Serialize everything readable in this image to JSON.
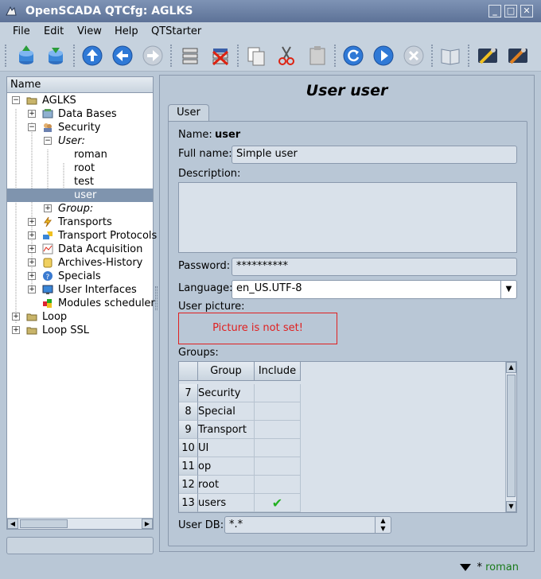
{
  "window": {
    "title": "OpenSCADA QTCfg: AGLKS",
    "minimize": "_",
    "maximize": "□",
    "close": "✕"
  },
  "menu": {
    "items": [
      "File",
      "Edit",
      "View",
      "Help",
      "QTStarter"
    ]
  },
  "toolbar": {
    "buttons": [
      "db-load-icon",
      "db-save-icon",
      "up-icon",
      "back-icon",
      "forward-icon",
      "add-item-icon",
      "delete-item-icon",
      "copy-icon",
      "cut-icon",
      "paste-icon",
      "refresh-icon",
      "start-icon",
      "stop-icon",
      "manual-icon",
      "tools-icon",
      "tools2-icon"
    ]
  },
  "tree": {
    "header": "Name",
    "nodes": [
      {
        "label": "AGLKS",
        "icon": "folder",
        "expander": "-"
      },
      {
        "label": "Data Bases",
        "icon": "db",
        "expander": "+"
      },
      {
        "label": "Security",
        "icon": "security",
        "expander": "-"
      },
      {
        "label": "User:",
        "icon": "",
        "expander": "-"
      },
      {
        "label": "roman",
        "icon": "",
        "expander": ""
      },
      {
        "label": "root",
        "icon": "",
        "expander": ""
      },
      {
        "label": "test",
        "icon": "",
        "expander": ""
      },
      {
        "label": "user",
        "icon": "",
        "expander": ""
      },
      {
        "label": "Group:",
        "icon": "",
        "expander": "+"
      },
      {
        "label": "Transports",
        "icon": "bolt",
        "expander": "+"
      },
      {
        "label": "Transport Protocols",
        "icon": "proto",
        "expander": "+"
      },
      {
        "label": "Data Acquisition",
        "icon": "chart",
        "expander": "+"
      },
      {
        "label": "Archives-History",
        "icon": "archive",
        "expander": "+"
      },
      {
        "label": "Specials",
        "icon": "help",
        "expander": "+"
      },
      {
        "label": "User Interfaces",
        "icon": "ui",
        "expander": "+"
      },
      {
        "label": "Modules scheduler",
        "icon": "modules",
        "expander": ""
      },
      {
        "label": "Loop",
        "icon": "folder",
        "expander": "+"
      },
      {
        "label": "Loop SSL",
        "icon": "folder",
        "expander": "+"
      }
    ]
  },
  "page": {
    "title": "User user",
    "tab": "User",
    "name_label": "Name:",
    "name_value": "user",
    "fullname_label": "Full name:",
    "fullname_value": "Simple user",
    "description_label": "Description:",
    "password_label": "Password:",
    "password_value": "**********",
    "language_label": "Language:",
    "language_value": "en_US.UTF-8",
    "picture_label": "User picture:",
    "picture_text": "Picture is not set!",
    "groups_label": "Groups:",
    "groups_columns": [
      "Group",
      "Include"
    ],
    "groups_rows": [
      {
        "n": "7",
        "group": "Security",
        "include": ""
      },
      {
        "n": "8",
        "group": "Special",
        "include": ""
      },
      {
        "n": "9",
        "group": "Transport",
        "include": ""
      },
      {
        "n": "10",
        "group": "UI",
        "include": ""
      },
      {
        "n": "11",
        "group": "op",
        "include": ""
      },
      {
        "n": "12",
        "group": "root",
        "include": ""
      },
      {
        "n": "13",
        "group": "users",
        "include": "✔"
      }
    ],
    "userdb_label": "User DB:",
    "userdb_value": "*.*"
  },
  "status": {
    "star": "*",
    "user": "roman"
  },
  "colors": {
    "selection": "#7f94ae",
    "picture_border": "#e02020",
    "status_user": "#1a7a1a",
    "check": "#22b022"
  }
}
